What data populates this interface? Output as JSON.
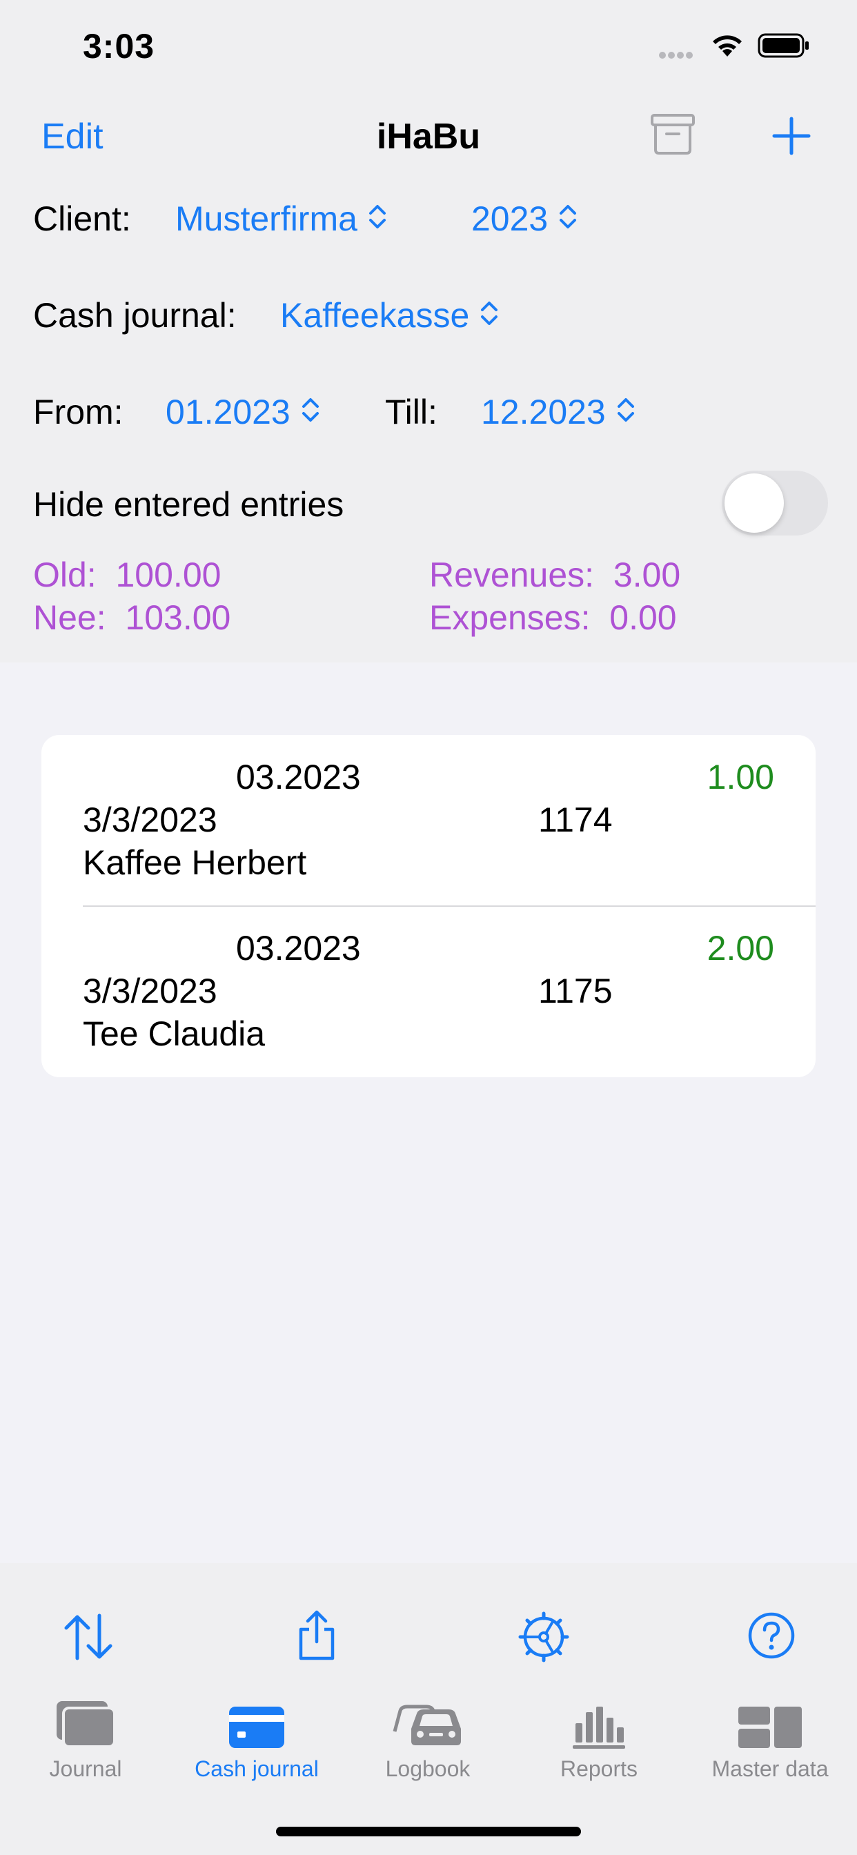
{
  "status_bar": {
    "time": "3:03"
  },
  "nav": {
    "edit_label": "Edit",
    "title": "iHaBu"
  },
  "filters": {
    "client_label": "Client:",
    "client_value": "Musterfirma",
    "year_value": "2023",
    "cash_journal_label": "Cash journal:",
    "cash_journal_value": "Kaffeekasse",
    "from_label": "From:",
    "from_value": "01.2023",
    "till_label": "Till:",
    "till_value": "12.2023"
  },
  "hide_entries": {
    "label": "Hide entered entries",
    "enabled": false
  },
  "summary": {
    "old_label": "Old:",
    "old_value": "100.00",
    "new_label": "Nee:",
    "new_value": "103.00",
    "revenues_label": "Revenues:",
    "revenues_value": "3.00",
    "expenses_label": "Expenses:",
    "expenses_value": "0.00",
    "color": "#ae52d4"
  },
  "entries": [
    {
      "month": "03.2023",
      "amount": "1.00",
      "date": "3/3/2023",
      "doc_no": "1174",
      "text": "Kaffee Herbert"
    },
    {
      "month": "03.2023",
      "amount": "2.00",
      "date": "3/3/2023",
      "doc_no": "1175",
      "text": "Tee Claudia"
    }
  ],
  "toolbar_icons": [
    "sort-icon",
    "share-icon",
    "settings-icon",
    "help-icon"
  ],
  "tabs": [
    {
      "label": "Journal",
      "icon": "journal-icon",
      "active": false
    },
    {
      "label": "Cash journal",
      "icon": "cash-journal-icon",
      "active": true
    },
    {
      "label": "Logbook",
      "icon": "logbook-icon",
      "active": false
    },
    {
      "label": "Reports",
      "icon": "reports-icon",
      "active": false
    },
    {
      "label": "Master data",
      "icon": "master-data-icon",
      "active": false
    }
  ],
  "colors": {
    "accent": "#1a7cf5",
    "amount": "#1e8c1e",
    "inactive_tab": "#8a8a8e"
  }
}
